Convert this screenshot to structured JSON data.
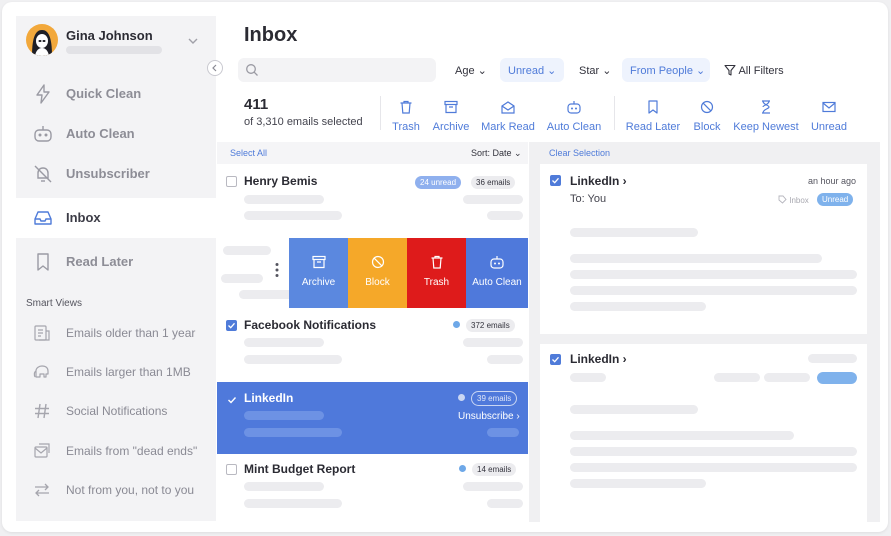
{
  "user": {
    "name": "Gina Johnson"
  },
  "sidebar": {
    "items": [
      {
        "label": "Quick Clean",
        "icon": "bolt-icon"
      },
      {
        "label": "Auto Clean",
        "icon": "robot-icon"
      },
      {
        "label": "Unsubscriber",
        "icon": "unsubscribe-icon"
      },
      {
        "label": "Inbox",
        "icon": "inbox-icon"
      },
      {
        "label": "Read Later",
        "icon": "bookmark-icon"
      }
    ],
    "smart_views_title": "Smart Views",
    "smart_views": [
      {
        "label": "Emails older than 1 year",
        "icon": "old-mail-icon"
      },
      {
        "label": "Emails larger than 1MB",
        "icon": "elephant-icon"
      },
      {
        "label": "Social Notifications",
        "icon": "hashtag-icon"
      },
      {
        "label": "Emails from \"dead ends\"",
        "icon": "dead-end-icon"
      },
      {
        "label": "Not from you, not to you",
        "icon": "swap-icon"
      }
    ]
  },
  "header": {
    "title": "Inbox",
    "filters": {
      "age": "Age",
      "unread": "Unread",
      "star": "Star",
      "from_people": "From People",
      "all_filters": "All Filters"
    }
  },
  "selection": {
    "count": "411",
    "summary": "of 3,310 emails selected"
  },
  "toolbar": [
    {
      "label": "Trash",
      "icon": "trash-icon"
    },
    {
      "label": "Archive",
      "icon": "archive-icon"
    },
    {
      "label": "Mark Read",
      "icon": "mark-read-icon"
    },
    {
      "label": "Auto Clean",
      "icon": "robot-icon"
    },
    {
      "label": "Read Later",
      "icon": "bookmark-icon"
    },
    {
      "label": "Block",
      "icon": "block-icon"
    },
    {
      "label": "Keep Newest",
      "icon": "hourglass-icon"
    },
    {
      "label": "Unread",
      "icon": "envelope-icon"
    }
  ],
  "list": {
    "select_all": "Select All",
    "sort": "Sort: Date",
    "rows": [
      {
        "sender": "Henry Bemis",
        "unread_badge": "24 unread",
        "count_badge": "36 emails",
        "checked": false
      },
      {
        "sender": "Facebook Notifications",
        "count_badge": "372 emails",
        "checked": true
      },
      {
        "sender": "LinkedIn",
        "count_badge": "39 emails",
        "action": "Unsubscribe ›",
        "checked": true
      },
      {
        "sender": "Mint Budget Report",
        "count_badge": "14 emails",
        "checked": false
      }
    ],
    "swipe_actions": [
      {
        "label": "Archive",
        "icon": "archive-icon",
        "color": "#5b88df"
      },
      {
        "label": "Block",
        "icon": "block-icon",
        "color": "#f5a829"
      },
      {
        "label": "Trash",
        "icon": "trash-icon",
        "color": "#de1b1b"
      },
      {
        "label": "Auto Clean",
        "icon": "robot-icon",
        "color": "#4f79db"
      }
    ]
  },
  "detail": {
    "clear_selection": "Clear Selection",
    "cards": [
      {
        "from": "LinkedIn ›",
        "to": "To: You",
        "time": "an hour ago",
        "tag": "Inbox",
        "badge": "Unread"
      },
      {
        "from": "LinkedIn ›"
      }
    ]
  },
  "colors": {
    "accent": "#4f7bd9",
    "selected_row": "#4f79db",
    "sidebar_bg": "#f3f3f5"
  }
}
